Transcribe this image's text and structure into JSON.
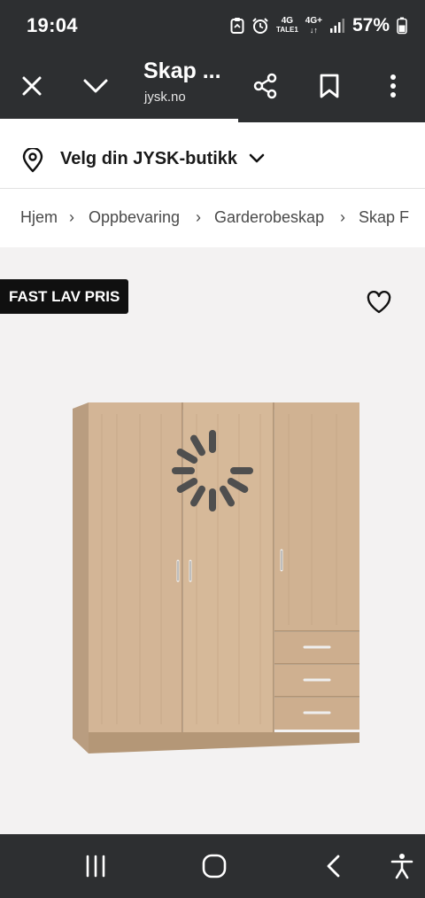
{
  "status_bar": {
    "time": "19:04",
    "network_1_top": "4G",
    "network_1_bottom": "TALE1",
    "network_2_top": "4G+",
    "network_2_bottom": "↓↑",
    "battery": "57%"
  },
  "toolbar": {
    "title": "Skap ...",
    "url": "jysk.no",
    "progress": 0.56
  },
  "store": {
    "label": "Velg din JYSK-butikk"
  },
  "breadcrumb": {
    "items": [
      "Hjem",
      "Oppbevaring",
      "Garderobeskap",
      "Skap F"
    ],
    "separator": "›"
  },
  "product": {
    "badge": "FAST LAV PRIS",
    "image_icon": "wardrobe-image",
    "loading_icon": "loading-spinner-icon"
  },
  "colors": {
    "chrome": "#2d2f31",
    "page_background": "#f3f2f2",
    "badge_background": "#101010",
    "wood": "#d2b394"
  }
}
